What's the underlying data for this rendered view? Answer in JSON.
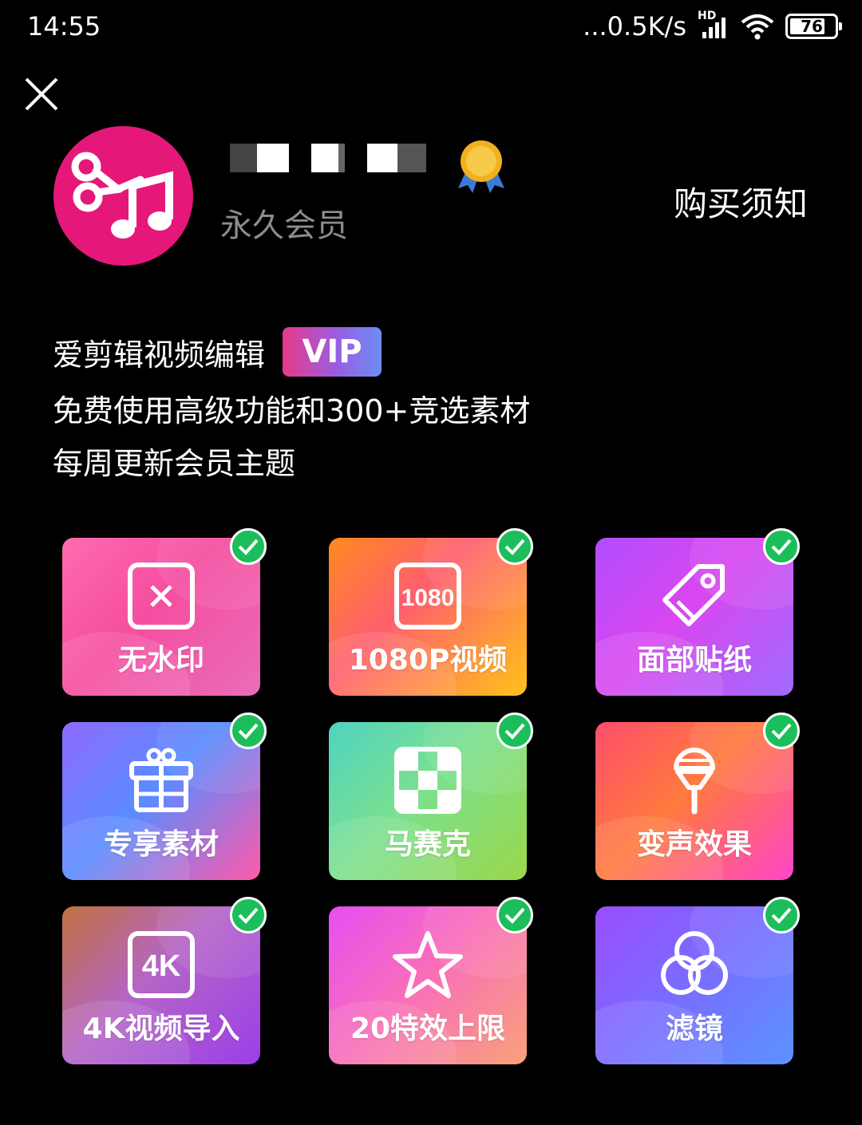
{
  "status_bar": {
    "time": "14:55",
    "network_speed": "...0.5K/s",
    "network_type": "HD",
    "battery_level": "76"
  },
  "profile": {
    "member_type": "永久会员",
    "purchase_notice": "购买须知"
  },
  "description": {
    "line1": "爱剪辑视频编辑",
    "vip_badge": "VIP",
    "line2": "免费使用高级功能和300+竞选素材",
    "line3": "每周更新会员主题"
  },
  "features": [
    {
      "label": "无水印",
      "icon": "no-watermark-icon",
      "checked": true
    },
    {
      "label": "1080P视频",
      "icon": "1080-icon",
      "icon_text": "1080",
      "checked": true
    },
    {
      "label": "面部贴纸",
      "icon": "tag-icon",
      "checked": true
    },
    {
      "label": "专享素材",
      "icon": "gift-icon",
      "checked": true
    },
    {
      "label": "马赛克",
      "icon": "mosaic-icon",
      "checked": true
    },
    {
      "label": "变声效果",
      "icon": "microphone-icon",
      "checked": true
    },
    {
      "label": "4K视频导入",
      "icon": "4k-icon",
      "icon_text": "4K",
      "checked": true
    },
    {
      "label": "20特效上限",
      "icon": "star-icon",
      "checked": true
    },
    {
      "label": "滤镜",
      "icon": "filter-icon",
      "checked": true
    }
  ],
  "colors": {
    "background": "#000000",
    "app_logo": "#e5187a",
    "check": "#1bbe5a",
    "muted_text": "#8d8d8d"
  }
}
